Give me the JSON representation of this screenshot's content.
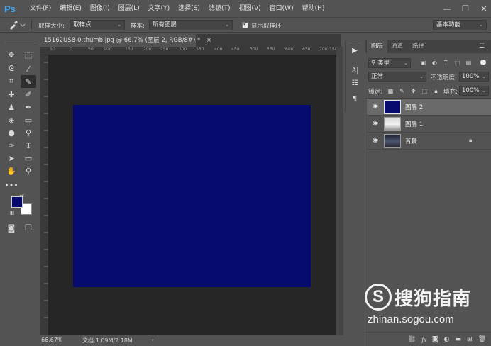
{
  "app": {
    "logo": "Ps"
  },
  "menu": [
    "文件(F)",
    "编辑(E)",
    "图像(I)",
    "图层(L)",
    "文字(Y)",
    "选择(S)",
    "滤镜(T)",
    "视图(V)",
    "窗口(W)",
    "帮助(H)"
  ],
  "window_controls": {
    "minimize": "—",
    "restore": "❐",
    "close": "✕"
  },
  "options_bar": {
    "sample_size_label": "取样大小:",
    "sample_size_value": "取样点",
    "sample_label": "样本:",
    "sample_value": "所有图层",
    "show_ring_label": "显示取样环",
    "show_ring_checked": true,
    "workspace_value": "基本功能"
  },
  "document": {
    "tab_title": "15162US8-0.thumb.jpg @ 66.7% (图层 2, RGB/8#) *",
    "tab_close": "×",
    "ruler_h_ticks": [
      "50",
      "0",
      "50",
      "100",
      "150",
      "200",
      "250",
      "300",
      "350",
      "400",
      "450",
      "500",
      "550",
      "600",
      "650",
      "700",
      "750"
    ],
    "canvas_color": "#040a6e"
  },
  "status": {
    "zoom": "66.67%",
    "doc_info": "文档:1.09M/2.18M",
    "arrow": "›"
  },
  "colors": {
    "foreground": "#050a6c",
    "background": "#ffffff"
  },
  "layers_panel": {
    "tabs": [
      "图层",
      "通道",
      "路径"
    ],
    "active_tab": 0,
    "filter_kind": "类型",
    "blend_mode": "正常",
    "opacity_label": "不透明度:",
    "opacity_value": "100%",
    "lock_label": "锁定:",
    "fill_label": "填充:",
    "fill_value": "100%",
    "layers": [
      {
        "name": "图层 2",
        "selected": true,
        "thumb": "navy",
        "locked": false
      },
      {
        "name": "图层 1",
        "selected": false,
        "thumb": "photo-light",
        "locked": false
      },
      {
        "name": "背景",
        "selected": false,
        "thumb": "photo-dark",
        "locked": true
      }
    ]
  },
  "watermark": {
    "logo_letter": "S",
    "brand": "搜狗指南",
    "url": "zhinan.sogou.com"
  }
}
